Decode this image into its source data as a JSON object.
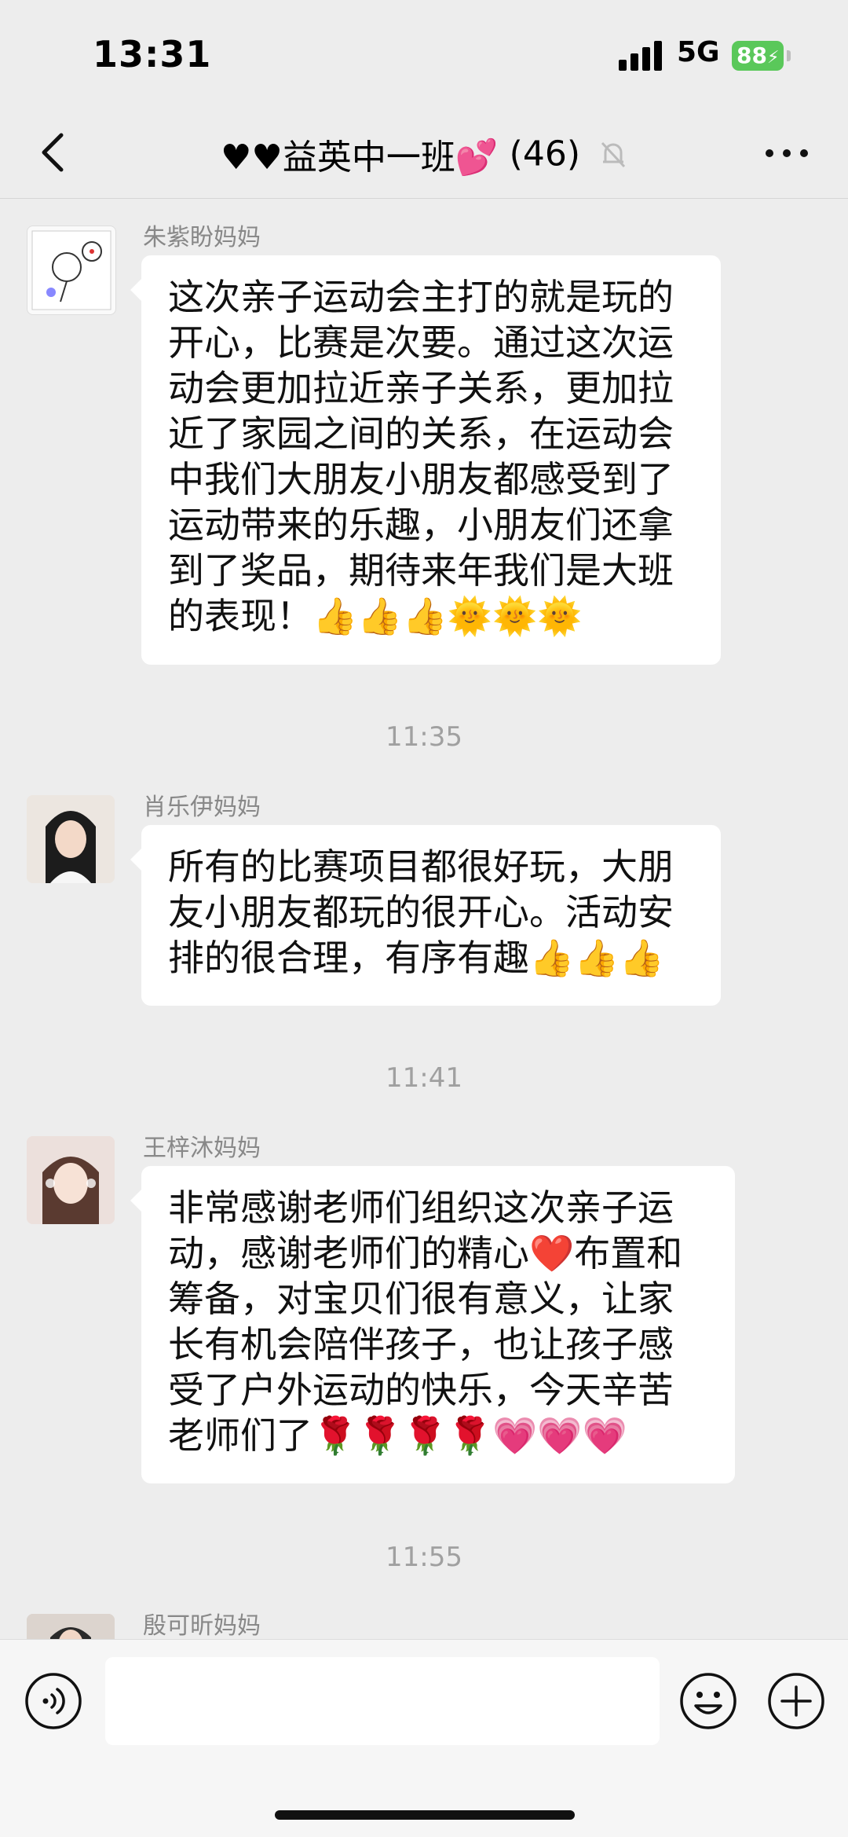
{
  "status_bar": {
    "time": "13:31",
    "network": "5G",
    "battery": "88"
  },
  "header": {
    "title": "♥♥益英中一班💕",
    "member_count": "(46)"
  },
  "messages": [
    {
      "sender": "朱紫盼妈妈",
      "text": "这次亲子运动会主打的就是玩的开心，比赛是次要。通过这次运动会更加拉近亲子关系，更加拉近了家园之间的关系，在运动会中我们大朋友小朋友都感受到了运动带来的乐趣，小朋友们还拿到了奖品，期待来年我们是大班的表现！👍👍👍🌞🌞🌞"
    },
    {
      "timestamp": "11:35"
    },
    {
      "sender": "肖乐伊妈妈",
      "text": "所有的比赛项目都很好玩，大朋友小朋友都玩的很开心。活动安排的很合理，有序有趣👍👍👍"
    },
    {
      "timestamp": "11:41"
    },
    {
      "sender": "王梓沐妈妈",
      "text": "非常感谢老师们组织这次亲子运动，感谢老师们的精心❤️布置和筹备，对宝贝们很有意义，让家长有机会陪伴孩子，也让孩子感受了户外运动的快乐，今天辛苦老师们了🌹🌹🌹🌹💗💗💗"
    },
    {
      "timestamp": "11:55"
    },
    {
      "sender": "殷可昕妈妈"
    }
  ],
  "icons": {
    "back": "chevron-left-icon",
    "mute": "bell-slash-icon",
    "more": "more-dots-icon",
    "voice": "voice-icon",
    "emoji": "emoji-icon",
    "plus": "plus-icon"
  },
  "colors": {
    "background": "#ededed",
    "bubble": "#ffffff",
    "battery": "#5ac85a",
    "meta_text": "#888888"
  }
}
